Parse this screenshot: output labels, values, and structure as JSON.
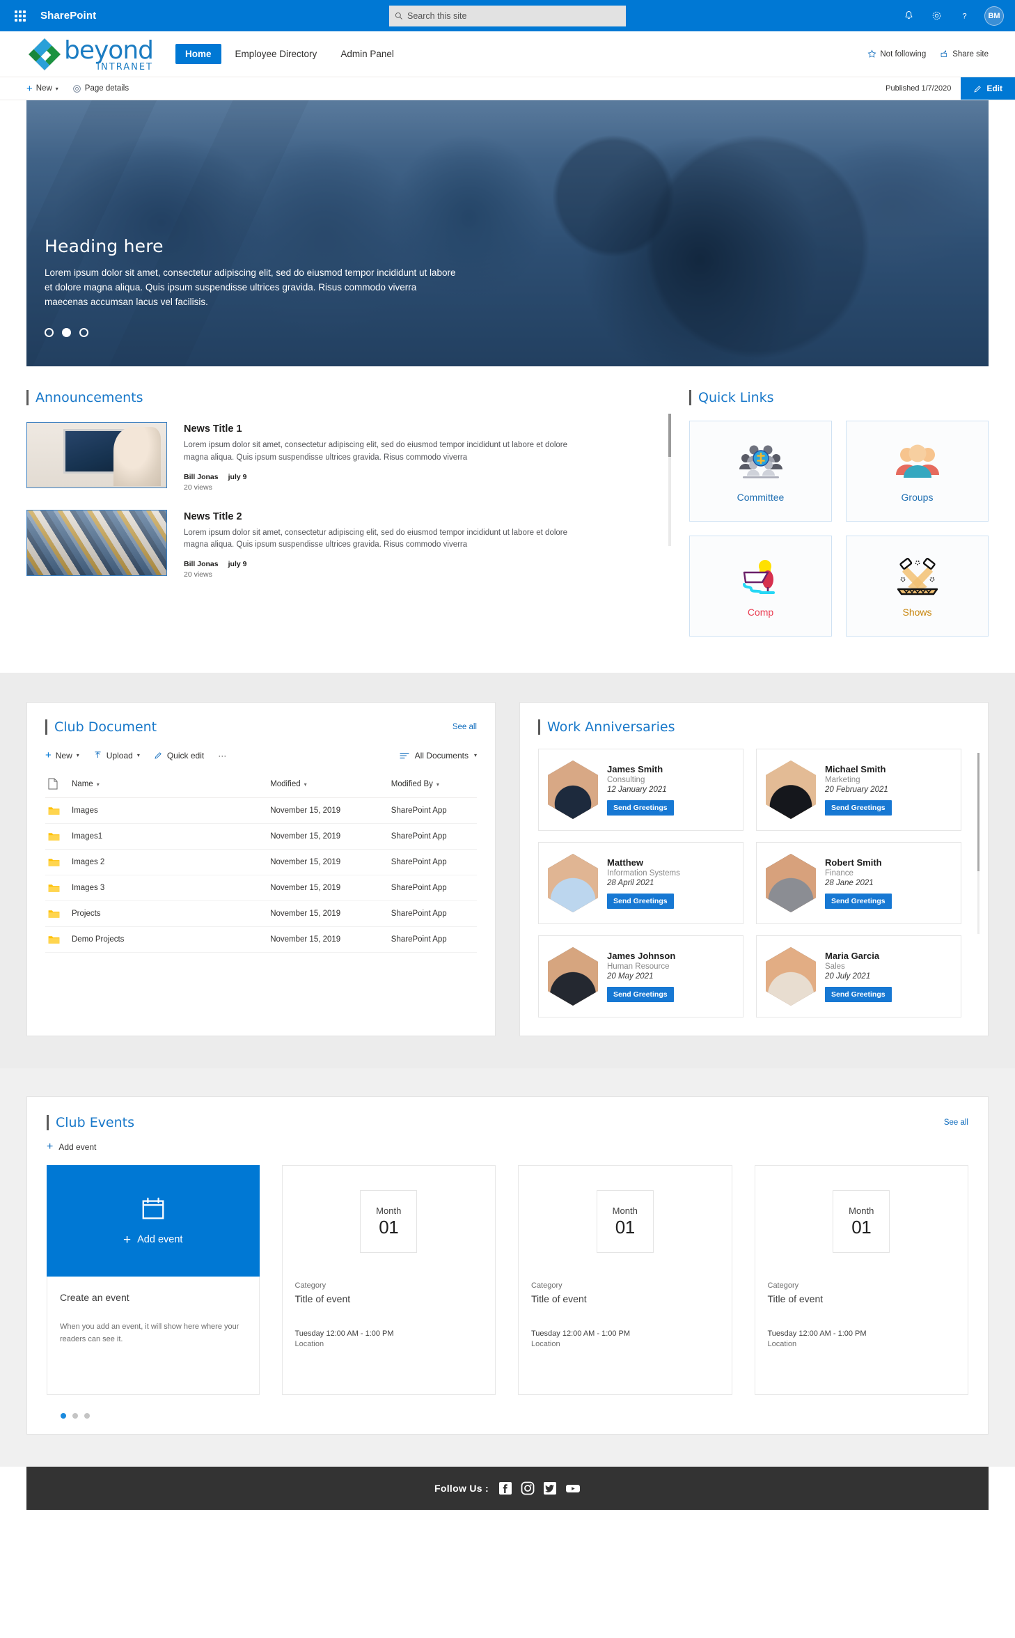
{
  "suitebar": {
    "waffle_label": "App launcher",
    "title": "SharePoint",
    "search_placeholder": "Search this site",
    "search_value": "",
    "notifications_icon": "bell-icon",
    "settings_icon": "gear-icon",
    "help_icon": "question-icon",
    "avatar_initials": "BM"
  },
  "site_header": {
    "logo_word": "beyond",
    "logo_sub": "INTRANET",
    "nav": [
      {
        "label": "Home",
        "active": true
      },
      {
        "label": "Employee Directory",
        "active": false
      },
      {
        "label": "Admin Panel",
        "active": false
      }
    ],
    "follow_label": "Not following",
    "share_label": "Share site"
  },
  "command_bar": {
    "new_label": "New",
    "page_details_label": "Page details",
    "published_label": "Published 1/7/2020",
    "edit_label": "Edit"
  },
  "hero": {
    "title": "Heading here",
    "body": "Lorem ipsum dolor sit amet, consectetur adipiscing elit, sed do eiusmod tempor incididunt ut labore et dolore magna aliqua. Quis ipsum suspendisse ultrices gravida. Risus commodo viverra maecenas accumsan lacus vel facilisis.",
    "dots": [
      {
        "active": false
      },
      {
        "active": true
      },
      {
        "active": false
      }
    ]
  },
  "announcements": {
    "title": "Announcements",
    "items": [
      {
        "title": "News Title 1",
        "desc": "Lorem ipsum dolor sit amet, consectetur adipiscing elit, sed do eiusmod tempor incididunt ut labore et dolore magna aliqua. Quis ipsum suspendisse ultrices gravida. Risus commodo viverra",
        "author": "Bill Jonas",
        "date": "july 9",
        "views": "20 views"
      },
      {
        "title": "News Title 2",
        "desc": "Lorem ipsum dolor sit amet, consectetur adipiscing elit, sed do eiusmod tempor incididunt ut labore et dolore magna aliqua. Quis ipsum suspendisse ultrices gravida. Risus commodo viverra",
        "author": "Bill Jonas",
        "date": "july 9",
        "views": "20 views"
      }
    ]
  },
  "quick_links": {
    "title": "Quick Links",
    "items": [
      {
        "label": "Committee",
        "icon": "committee-people-icon",
        "color": "#1f6fb2"
      },
      {
        "label": "Groups",
        "icon": "groups-people-icon",
        "color": "#1f6fb2"
      },
      {
        "label": "Comp",
        "icon": "comp-stage-icon",
        "color": "#ea3d52"
      },
      {
        "label": "Shows",
        "icon": "shows-spotlight-icon",
        "color": "#c8860d"
      }
    ]
  },
  "club_document": {
    "title": "Club  Document",
    "see_all": "See all",
    "toolbar": {
      "new_label": "New",
      "upload_label": "Upload",
      "quick_edit_label": "Quick edit",
      "more_label": "···",
      "view_label": "All Documents"
    },
    "columns": [
      "Name",
      "Modified",
      "Modified By"
    ],
    "rows": [
      {
        "name": "Images",
        "modified": "November 15, 2019",
        "modified_by": "SharePoint App"
      },
      {
        "name": "Images1",
        "modified": "November 15, 2019",
        "modified_by": "SharePoint App"
      },
      {
        "name": "Images 2",
        "modified": "November 15, 2019",
        "modified_by": "SharePoint App"
      },
      {
        "name": "Images 3",
        "modified": "November 15, 2019",
        "modified_by": "SharePoint App"
      },
      {
        "name": "Projects",
        "modified": "November 15, 2019",
        "modified_by": "SharePoint App"
      },
      {
        "name": "Demo Projects",
        "modified": "November 15, 2019",
        "modified_by": "SharePoint App"
      }
    ]
  },
  "work_anniversaries": {
    "title": "Work Anniversaries",
    "button_label": "Send Greetings",
    "people": [
      {
        "name": "James Smith",
        "dept": "Consulting",
        "date": "12 January 2021"
      },
      {
        "name": "Michael Smith",
        "dept": "Marketing",
        "date": "20 February 2021"
      },
      {
        "name": "Matthew",
        "dept": "Information Systems",
        "date": "28 April 2021"
      },
      {
        "name": "Robert Smith",
        "dept": "Finance",
        "date": "28 Jane 2021"
      },
      {
        "name": "James Johnson",
        "dept": "Human Resource",
        "date": "20 May 2021"
      },
      {
        "name": "Maria Garcia",
        "dept": "Sales",
        "date": "20 July 2021"
      }
    ]
  },
  "club_events": {
    "title": "Club Events",
    "see_all": "See all",
    "add_event_link": "Add event",
    "create_card": {
      "tile_label": "Add event",
      "heading": "Create an event",
      "note": "When you add an event, it will show here where your readers can see it."
    },
    "events": [
      {
        "month": "Month",
        "day": "01",
        "category": "Category",
        "title": "Title of event",
        "time": "Tuesday 12:00 AM - 1:00 PM",
        "location": "Location"
      },
      {
        "month": "Month",
        "day": "01",
        "category": "Category",
        "title": "Title of event",
        "time": "Tuesday 12:00 AM - 1:00 PM",
        "location": "Location"
      },
      {
        "month": "Month",
        "day": "01",
        "category": "Category",
        "title": "Title of event",
        "time": "Tuesday 12:00 AM - 1:00 PM",
        "location": "Location"
      }
    ],
    "dots": [
      {
        "active": true
      },
      {
        "active": false
      },
      {
        "active": false
      }
    ]
  },
  "footer": {
    "follow_label": "Follow Us :",
    "socials": [
      {
        "name": "facebook-icon"
      },
      {
        "name": "instagram-icon"
      },
      {
        "name": "twitter-icon"
      },
      {
        "name": "youtube-icon"
      }
    ]
  },
  "colors": {
    "brand_blue": "#0078d4",
    "link_blue": "#1878c9",
    "footer_dark": "#333333",
    "grey_band": "#ececec"
  }
}
